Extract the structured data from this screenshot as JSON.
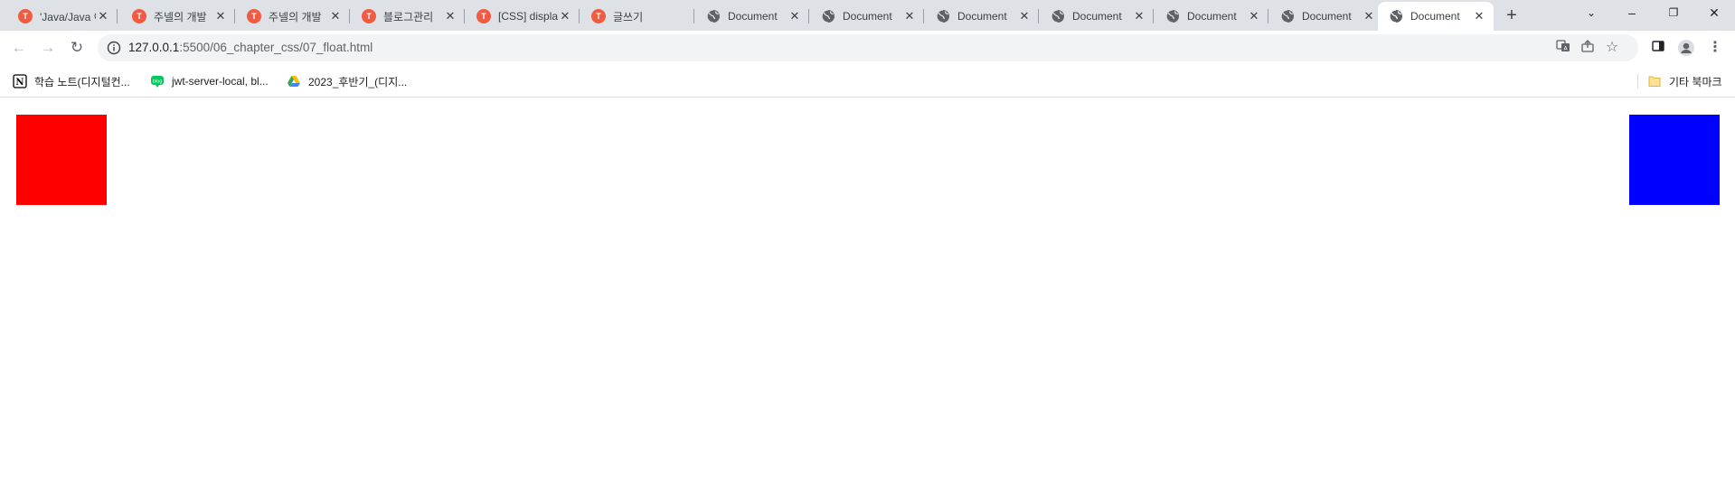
{
  "tabs": [
    {
      "title": "'Java/Java 이",
      "favicon": "tistory"
    },
    {
      "title": "주넬의 개발",
      "favicon": "tistory"
    },
    {
      "title": "주넬의 개발",
      "favicon": "tistory"
    },
    {
      "title": "블로그관리",
      "favicon": "tistory"
    },
    {
      "title": "[CSS] displa",
      "favicon": "tistory"
    },
    {
      "title": "글쓰기",
      "favicon": "tistory"
    },
    {
      "title": "Document",
      "favicon": "globe"
    },
    {
      "title": "Document",
      "favicon": "globe"
    },
    {
      "title": "Document",
      "favicon": "globe"
    },
    {
      "title": "Document",
      "favicon": "globe"
    },
    {
      "title": "Document",
      "favicon": "globe"
    },
    {
      "title": "Document",
      "favicon": "globe"
    },
    {
      "title": "Document",
      "favicon": "globe",
      "active": true
    }
  ],
  "address": {
    "host": "127.0.0.1",
    "path": ":5500/06_chapter_css/07_float.html"
  },
  "bookmarks": [
    {
      "label": "학습 노트(디지털컨...",
      "icon": "notion-icon"
    },
    {
      "label": "jwt-server-local, bl...",
      "icon": "blog-icon"
    },
    {
      "label": "2023_후반기_(디지...",
      "icon": "google-drive-icon"
    }
  ],
  "other_bookmarks": "기타 북마크",
  "colors": {
    "left_box": "#ff0000",
    "right_box": "#0000ff"
  }
}
